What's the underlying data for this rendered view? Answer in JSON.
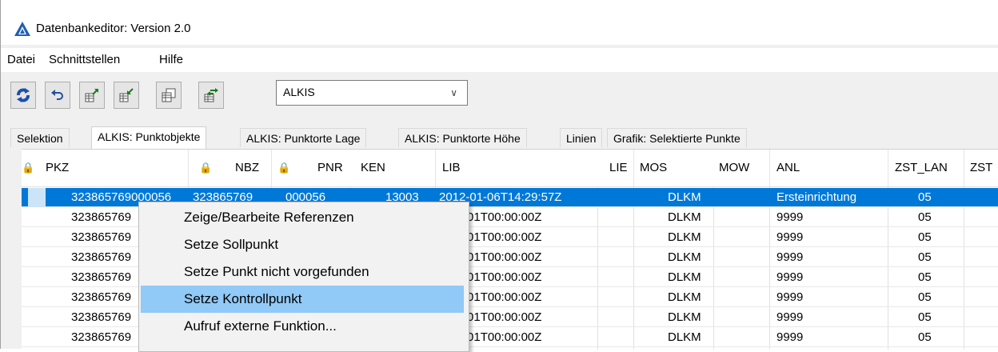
{
  "window": {
    "title": "Datenbankeditor: Version 2.0",
    "icon": "app-logo-icon"
  },
  "menu": [
    "Datei",
    "Schnittstellen",
    "Hilfe"
  ],
  "toolbar": {
    "buttons": [
      "refresh-icon",
      "undo-icon",
      "table-export-icon",
      "table-import-icon",
      "table-copy-icon",
      "table-swap-icon"
    ],
    "combo_value": "ALKIS",
    "combo_arrow": "∨"
  },
  "tabs": [
    "Selektion",
    "ALKIS: Punktobjekte",
    "ALKIS: Punktorte Lage",
    "ALKIS: Punktorte Höhe",
    "Linien",
    "Grafik: Selektierte Punkte"
  ],
  "active_tab": 1,
  "grid": {
    "columns": [
      "PKZ",
      "NBZ",
      "PNR",
      "KEN",
      "LIB",
      "LIE",
      "MOS",
      "MOW",
      "ANL",
      "ZST_LAN",
      "ZST"
    ],
    "lock_icon": "🔒",
    "rows": [
      {
        "pkz": "323865769000056",
        "nbz": "323865769",
        "pnr": "000056",
        "ken": "13003",
        "lib": "2012-01-06T14:29:57Z",
        "mos": "DLKM",
        "anl": "Ersteinrichtung",
        "zst": "05"
      },
      {
        "pkz": "323865769",
        "lib": "9-01-01T00:00:00Z",
        "mos": "DLKM",
        "anl": "9999",
        "zst": "05"
      },
      {
        "pkz": "323865769",
        "lib": "9-01-01T00:00:00Z",
        "mos": "DLKM",
        "anl": "9999",
        "zst": "05"
      },
      {
        "pkz": "323865769",
        "lib": "9-01-01T00:00:00Z",
        "mos": "DLKM",
        "anl": "9999",
        "zst": "05"
      },
      {
        "pkz": "323865769",
        "lib": "9-01-01T00:00:00Z",
        "mos": "DLKM",
        "anl": "9999",
        "zst": "05"
      },
      {
        "pkz": "323865769",
        "lib": "9-01-01T00:00:00Z",
        "mos": "DLKM",
        "anl": "9999",
        "zst": "05"
      },
      {
        "pkz": "323865769",
        "lib": "9-01-01T00:00:00Z",
        "mos": "DLKM",
        "anl": "9999",
        "zst": "05"
      },
      {
        "pkz": "323865769",
        "lib": "9-01-01T00:00:00Z",
        "mos": "DLKM",
        "anl": "9999",
        "zst": "05"
      }
    ]
  },
  "context_menu": {
    "items": [
      "Zeige/Bearbeite Referenzen",
      "Setze Sollpunkt",
      "Setze Punkt nicht vorgefunden",
      "Setze Kontrollpunkt",
      "Aufruf externe Funktion..."
    ],
    "hovered": 3
  }
}
